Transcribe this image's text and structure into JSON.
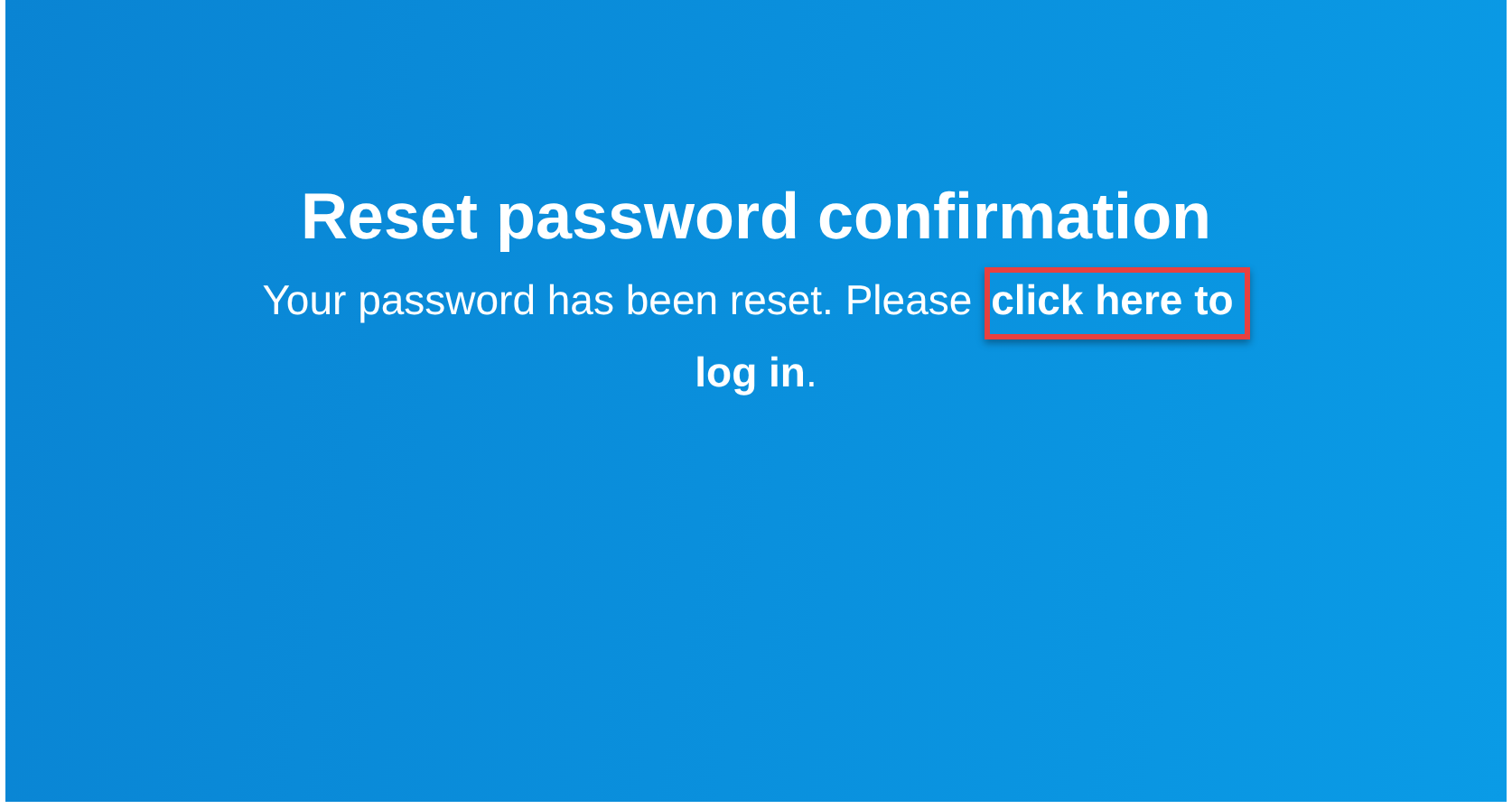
{
  "title": "Reset password confirmation",
  "message": {
    "text": "Your password has been reset. Please ",
    "link_lines": [
      "click here to",
      "log in"
    ],
    "end": ".",
    "highlighted": true
  }
}
